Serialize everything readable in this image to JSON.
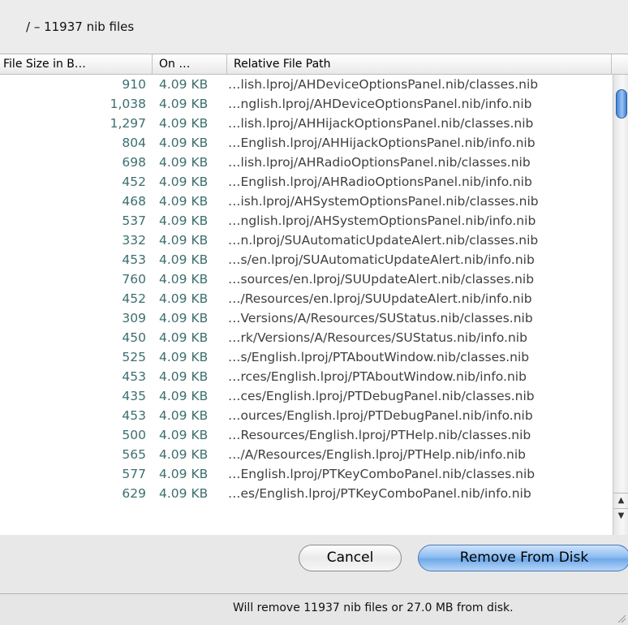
{
  "header": {
    "title": "/ – 11937 nib files"
  },
  "table": {
    "columns": [
      "File Size in B…",
      "On …",
      "Relative File Path"
    ],
    "rows": [
      {
        "size": "910",
        "on": "4.09 KB",
        "path": "…lish.lproj/AHDeviceOptionsPanel.nib/classes.nib"
      },
      {
        "size": "1,038",
        "on": "4.09 KB",
        "path": "…nglish.lproj/AHDeviceOptionsPanel.nib/info.nib"
      },
      {
        "size": "1,297",
        "on": "4.09 KB",
        "path": "…lish.lproj/AHHijackOptionsPanel.nib/classes.nib"
      },
      {
        "size": "804",
        "on": "4.09 KB",
        "path": "…English.lproj/AHHijackOptionsPanel.nib/info.nib"
      },
      {
        "size": "698",
        "on": "4.09 KB",
        "path": "…lish.lproj/AHRadioOptionsPanel.nib/classes.nib"
      },
      {
        "size": "452",
        "on": "4.09 KB",
        "path": "…English.lproj/AHRadioOptionsPanel.nib/info.nib"
      },
      {
        "size": "468",
        "on": "4.09 KB",
        "path": "…ish.lproj/AHSystemOptionsPanel.nib/classes.nib"
      },
      {
        "size": "537",
        "on": "4.09 KB",
        "path": "…nglish.lproj/AHSystemOptionsPanel.nib/info.nib"
      },
      {
        "size": "332",
        "on": "4.09 KB",
        "path": "…n.lproj/SUAutomaticUpdateAlert.nib/classes.nib"
      },
      {
        "size": "453",
        "on": "4.09 KB",
        "path": "…s/en.lproj/SUAutomaticUpdateAlert.nib/info.nib"
      },
      {
        "size": "760",
        "on": "4.09 KB",
        "path": "…sources/en.lproj/SUUpdateAlert.nib/classes.nib"
      },
      {
        "size": "452",
        "on": "4.09 KB",
        "path": "…/Resources/en.lproj/SUUpdateAlert.nib/info.nib"
      },
      {
        "size": "309",
        "on": "4.09 KB",
        "path": "…Versions/A/Resources/SUStatus.nib/classes.nib"
      },
      {
        "size": "450",
        "on": "4.09 KB",
        "path": "…rk/Versions/A/Resources/SUStatus.nib/info.nib"
      },
      {
        "size": "525",
        "on": "4.09 KB",
        "path": "…s/English.lproj/PTAboutWindow.nib/classes.nib"
      },
      {
        "size": "453",
        "on": "4.09 KB",
        "path": "…rces/English.lproj/PTAboutWindow.nib/info.nib"
      },
      {
        "size": "435",
        "on": "4.09 KB",
        "path": "…ces/English.lproj/PTDebugPanel.nib/classes.nib"
      },
      {
        "size": "453",
        "on": "4.09 KB",
        "path": "…ources/English.lproj/PTDebugPanel.nib/info.nib"
      },
      {
        "size": "500",
        "on": "4.09 KB",
        "path": "…Resources/English.lproj/PTHelp.nib/classes.nib"
      },
      {
        "size": "565",
        "on": "4.09 KB",
        "path": "…/A/Resources/English.lproj/PTHelp.nib/info.nib"
      },
      {
        "size": "577",
        "on": "4.09 KB",
        "path": "…English.lproj/PTKeyComboPanel.nib/classes.nib"
      },
      {
        "size": "629",
        "on": "4.09 KB",
        "path": "…es/English.lproj/PTKeyComboPanel.nib/info.nib"
      }
    ]
  },
  "buttons": {
    "cancel": "Cancel",
    "remove": "Remove From Disk"
  },
  "status": {
    "text": "Will remove 11937 nib files or 27.0 MB from disk."
  },
  "icons": {
    "scroll_up": "scroll-up-arrow-icon",
    "scroll_down": "scroll-down-arrow-icon",
    "resize": "resize-grip-icon"
  }
}
